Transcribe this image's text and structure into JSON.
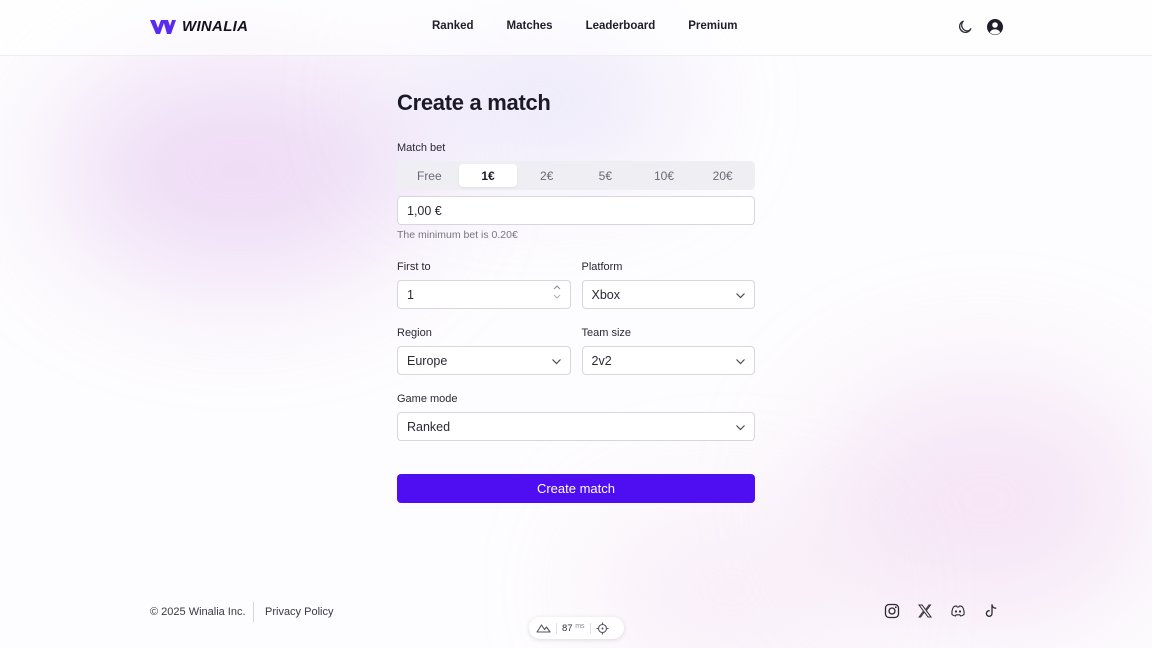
{
  "brand": {
    "name": "WINALIA",
    "accent": "#4f0ef2",
    "logo_color": "#5a2af0"
  },
  "nav": {
    "items": [
      "Ranked",
      "Matches",
      "Leaderboard",
      "Premium"
    ]
  },
  "header_icons": [
    "moon-icon",
    "user-account-icon"
  ],
  "form": {
    "title": "Create a match",
    "bet": {
      "label": "Match bet",
      "options": [
        "Free",
        "1€",
        "2€",
        "5€",
        "10€",
        "20€"
      ],
      "selected": "1€",
      "value": "1,00 €",
      "hint": "The minimum bet is 0.20€"
    },
    "first_to": {
      "label": "First to",
      "value": "1"
    },
    "platform": {
      "label": "Platform",
      "value": "Xbox"
    },
    "region": {
      "label": "Region",
      "value": "Europe"
    },
    "team_size": {
      "label": "Team size",
      "value": "2v2"
    },
    "game_mode": {
      "label": "Game mode",
      "value": "Ranked"
    },
    "submit_label": "Create match"
  },
  "footer": {
    "copyright": "© 2025 Winalia Inc.",
    "privacy": "Privacy Policy",
    "social_icons": [
      "instagram-icon",
      "x-icon",
      "discord-icon",
      "tiktok-icon"
    ]
  },
  "status": {
    "latency": "87",
    "unit": "ms"
  }
}
